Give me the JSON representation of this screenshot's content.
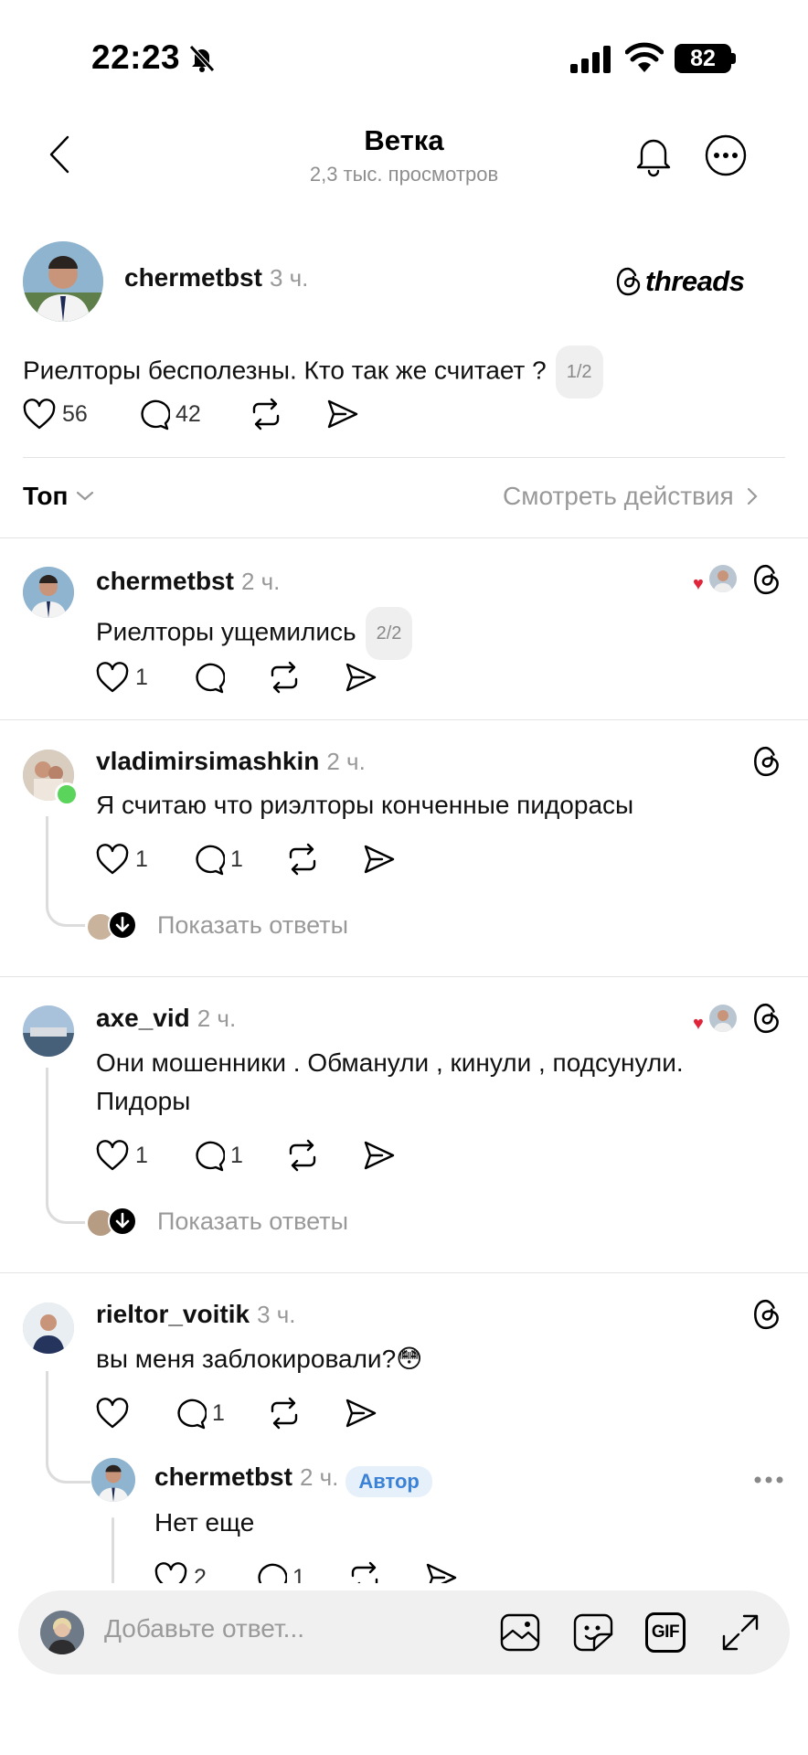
{
  "status_bar": {
    "time": "22:23",
    "battery": "82"
  },
  "header": {
    "title": "Ветка",
    "subtitle": "2,3 тыс. просмотров"
  },
  "post": {
    "username": "chermetbst",
    "time": "3 ч.",
    "brand": "threads",
    "text": "Риелторы бесполезны. Кто так же считает ?",
    "pager": "1/2",
    "likes": "56",
    "comments": "42"
  },
  "sort": {
    "label": "Топ",
    "activity": "Смотреть действия"
  },
  "replies": [
    {
      "username": "chermetbst",
      "time": "2 ч.",
      "text": "Риелторы ущемились",
      "pager": "2/2",
      "likes": "1",
      "comments": ""
    },
    {
      "username": "vladimirsimashkin",
      "time": "2 ч.",
      "text": "Я считаю что риэлторы конченные пидорасы",
      "likes": "1",
      "comments": "1",
      "show_replies": "Показать ответы"
    },
    {
      "username": "axe_vid",
      "time": "2 ч.",
      "text_line1": "Они мошенники . Обманули , кинули , подсунули.",
      "text_line2": "Пидоры",
      "likes": "1",
      "comments": "1",
      "show_replies": "Показать ответы"
    },
    {
      "username": "rieltor_voitik",
      "time": "3 ч.",
      "text": "вы меня заблокировали?😳",
      "likes": "",
      "comments": "1"
    }
  ],
  "nested_reply": {
    "username": "chermetbst",
    "time": "2 ч.",
    "badge": "Автор",
    "text": "Нет еще",
    "likes": "2",
    "comments": "1"
  },
  "composer": {
    "placeholder": "Добавьте ответ...",
    "gif_label": "GIF"
  }
}
